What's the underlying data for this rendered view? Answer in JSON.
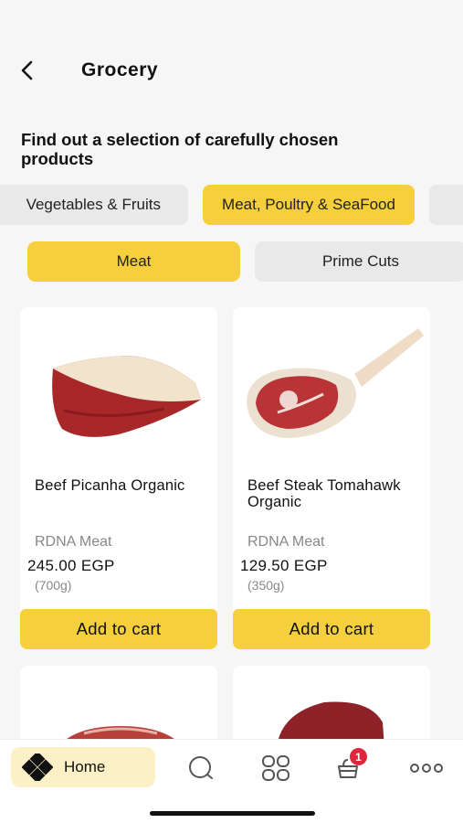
{
  "header": {
    "title": "Grocery"
  },
  "intro": "Find out a selection of carefully chosen products",
  "categories": [
    {
      "label": "Vegetables & Fruits",
      "active": false
    },
    {
      "label": "Meat, Poultry & SeaFood",
      "active": true
    },
    {
      "label": "",
      "active": false
    }
  ],
  "subcategories": [
    {
      "label": "Meat",
      "active": true
    },
    {
      "label": "Prime Cuts",
      "active": false
    }
  ],
  "products": [
    {
      "name": "Beef Picanha Organic",
      "brand": "RDNA Meat",
      "price": "245.00 EGP",
      "weight": "(700g)",
      "button": "Add to cart"
    },
    {
      "name": "Beef Steak Tomahawk Organic",
      "brand": "RDNA Meat",
      "price": "129.50 EGP",
      "weight": "(350g)",
      "button": "Add to cart"
    }
  ],
  "bottom_nav": {
    "home_label": "Home",
    "cart_badge": "1"
  },
  "colors": {
    "accent": "#f6cf3c",
    "chip_inactive": "#e9e9e9",
    "badge": "#e0263a",
    "home_bg": "#fbf0c6"
  },
  "icons": [
    "back-arrow-icon",
    "home-logo-icon",
    "search-icon",
    "categories-icon",
    "cart-icon",
    "more-icon"
  ]
}
